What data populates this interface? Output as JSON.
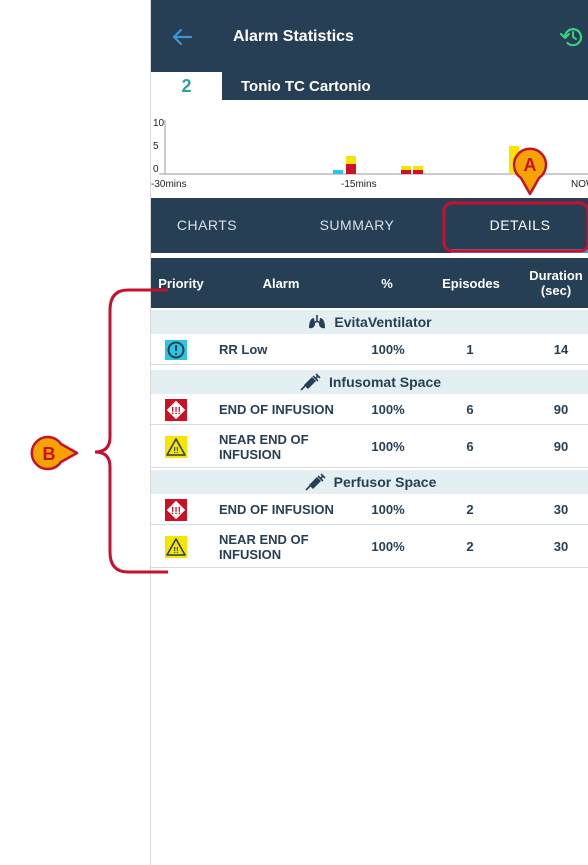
{
  "app": {
    "title": "Alarm Statistics"
  },
  "patient": {
    "bed": "2",
    "name": "Tonio TC Cartonio"
  },
  "mini_chart": {
    "y_ticks": [
      "10",
      "5",
      "0"
    ],
    "x_ticks": [
      "-30mins",
      "-15mins",
      "NOW"
    ],
    "colors": {
      "yellow": "#f7e400",
      "red": "#cc1124",
      "cyan": "#29c8e0"
    }
  },
  "tabs": [
    "CHARTS",
    "SUMMARY",
    "DETAILS"
  ],
  "table": {
    "headers": {
      "priority": "Priority",
      "alarm": "Alarm",
      "percent": "%",
      "episodes": "Episodes",
      "duration": "Duration (sec)"
    },
    "groups": [
      {
        "name": "EvitaVentilator",
        "icon": "lungs-icon",
        "rows": [
          {
            "priority_icon": "info-icon",
            "alarm": "RR Low",
            "percent": "100%",
            "episodes": "1",
            "duration": "14"
          }
        ]
      },
      {
        "name": "Infusomat Space",
        "icon": "syringe-icon",
        "rows": [
          {
            "priority_icon": "high-priority-icon",
            "alarm": "END OF INFUSION",
            "percent": "100%",
            "episodes": "6",
            "duration": "90"
          },
          {
            "priority_icon": "warning-icon",
            "alarm": "NEAR END OF INFUSION",
            "percent": "100%",
            "episodes": "6",
            "duration": "90"
          }
        ]
      },
      {
        "name": "Perfusor Space",
        "icon": "syringe-icon",
        "rows": [
          {
            "priority_icon": "high-priority-icon",
            "alarm": "END OF INFUSION",
            "percent": "100%",
            "episodes": "2",
            "duration": "30"
          },
          {
            "priority_icon": "warning-icon",
            "alarm": "NEAR END OF INFUSION",
            "percent": "100%",
            "episodes": "2",
            "duration": "30"
          }
        ]
      }
    ]
  },
  "annotations": {
    "a": "A",
    "b": "B"
  },
  "colors": {
    "header": "#263f54",
    "accent": "#3d95d6",
    "annotation": "#c8102e",
    "group_bg": "#e4eff2"
  }
}
